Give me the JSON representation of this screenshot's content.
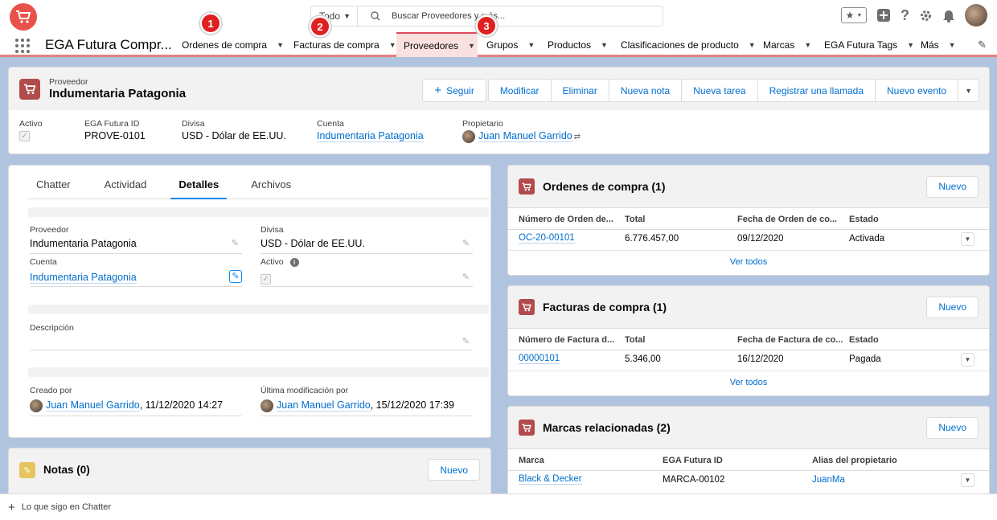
{
  "search": {
    "scope": "Todo",
    "placeholder": "Buscar Proveedores y más..."
  },
  "app": {
    "name": "EGA Futura Compr..."
  },
  "nav": {
    "items": [
      {
        "label": "Ordenes de compra"
      },
      {
        "label": "Facturas de compra"
      },
      {
        "label": "Proveedores"
      },
      {
        "label": "Grupos"
      },
      {
        "label": "Productos"
      },
      {
        "label": "Clasificaciones de producto"
      },
      {
        "label": "Marcas"
      },
      {
        "label": "EGA Futura Tags"
      },
      {
        "label": "Más"
      }
    ]
  },
  "badges": [
    "1",
    "2",
    "3"
  ],
  "record": {
    "type": "Proveedor",
    "name": "Indumentaria Patagonia",
    "actions": {
      "follow": "Seguir",
      "edit": "Modificar",
      "delete": "Eliminar",
      "new_note": "Nueva nota",
      "new_task": "Nueva tarea",
      "log_call": "Registrar una llamada",
      "new_event": "Nuevo evento"
    },
    "highlights": {
      "active_label": "Activo",
      "id_label": "EGA Futura ID",
      "id_value": "PROVE-0101",
      "currency_label": "Divisa",
      "currency_value": "USD - Dólar de EE.UU.",
      "account_label": "Cuenta",
      "account_value": "Indumentaria Patagonia",
      "owner_label": "Propietario",
      "owner_value": "Juan Manuel Garrido"
    }
  },
  "tabs": [
    "Chatter",
    "Actividad",
    "Detalles",
    "Archivos"
  ],
  "details": {
    "supplier_label": "Proveedor",
    "supplier_value": "Indumentaria Patagonia",
    "currency_label": "Divisa",
    "currency_value": "USD - Dólar de EE.UU.",
    "account_label": "Cuenta",
    "account_value": "Indumentaria Patagonia",
    "active_label": "Activo",
    "description_label": "Descripción",
    "created_label": "Creado por",
    "created_user": "Juan Manuel Garrido",
    "created_date": ", 11/12/2020 14:27",
    "modified_label": "Última modificación por",
    "modified_user": "Juan Manuel Garrido",
    "modified_date": ", 15/12/2020 17:39"
  },
  "notes": {
    "title": "Notas (0)",
    "new": "Nuevo"
  },
  "related": {
    "orders": {
      "title": "Ordenes de compra (1)",
      "new": "Nuevo",
      "columns": [
        "Número de Orden de...",
        "Total",
        "Fecha de Orden de co...",
        "Estado"
      ],
      "rows": [
        [
          "OC-20-00101",
          "6.776.457,00",
          "09/12/2020",
          "Activada"
        ]
      ],
      "view_all": "Ver todos"
    },
    "invoices": {
      "title": "Facturas de compra (1)",
      "new": "Nuevo",
      "columns": [
        "Número de Factura d...",
        "Total",
        "Fecha de Factura de co...",
        "Estado"
      ],
      "rows": [
        [
          "00000101",
          "5.346,00",
          "16/12/2020",
          "Pagada"
        ]
      ],
      "view_all": "Ver todos"
    },
    "brands": {
      "title": "Marcas relacionadas (2)",
      "new": "Nuevo",
      "columns": [
        "Marca",
        "EGA Futura ID",
        "Alias del propietario"
      ],
      "rows": [
        [
          "Black & Decker",
          "MARCA-00102",
          "JuanMa"
        ]
      ]
    }
  },
  "footer": {
    "label": "Lo que sigo en Chatter"
  },
  "colors": {
    "brand": "#e8524a",
    "record_icon": "#b24c4c",
    "link": "#006dcc",
    "badge": "#e02020"
  }
}
